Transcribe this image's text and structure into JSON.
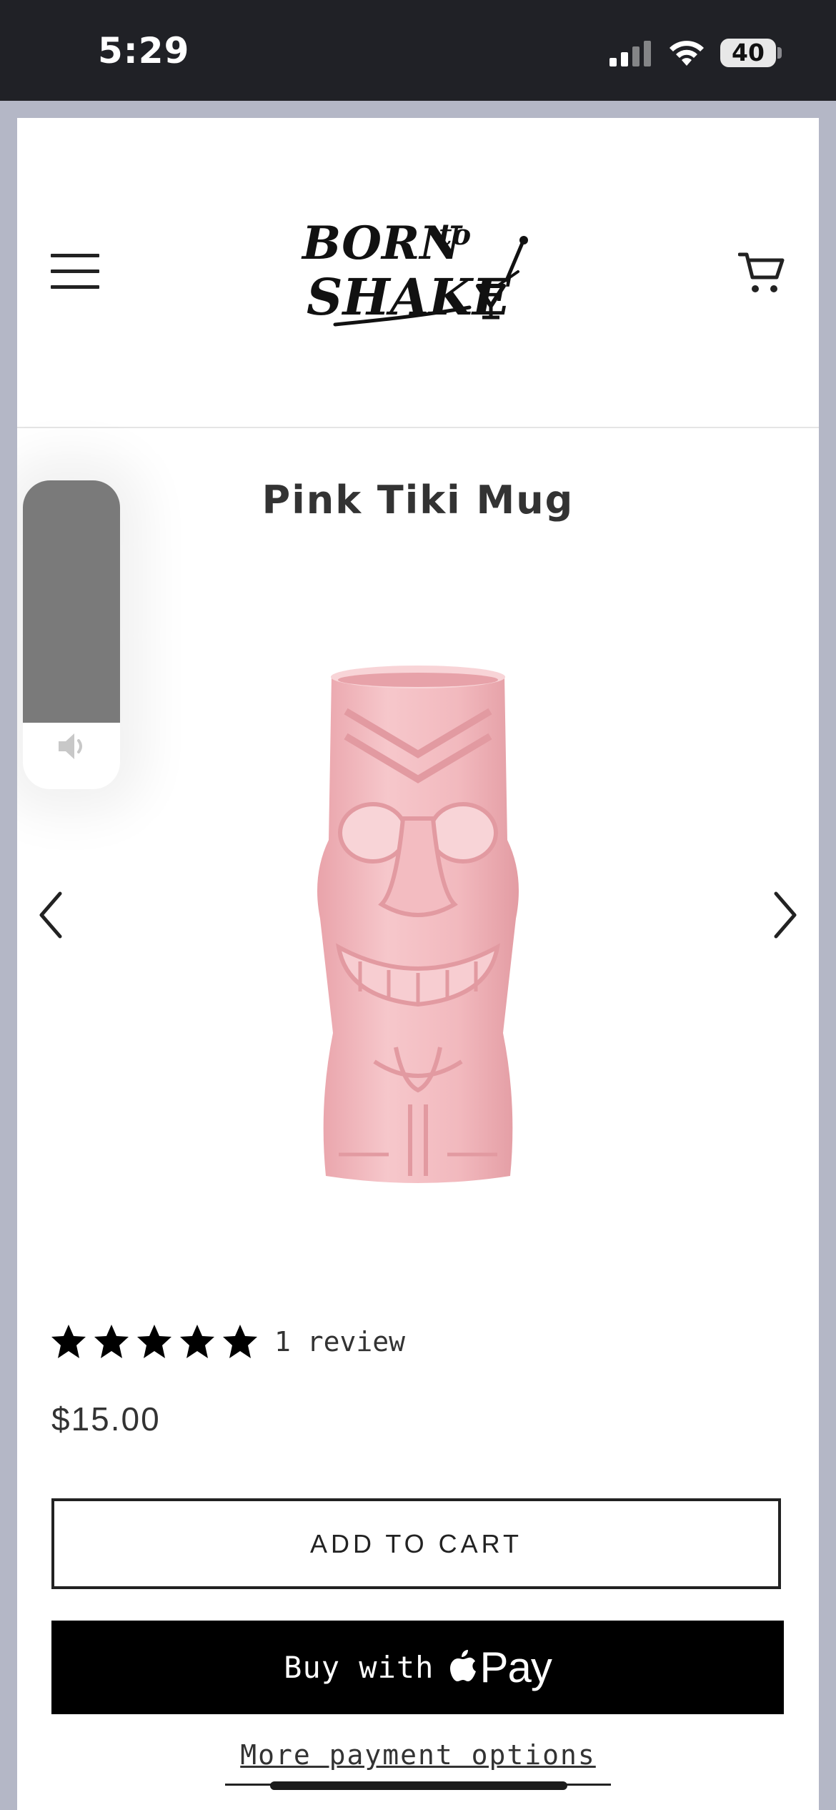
{
  "status_bar": {
    "time": "5:29",
    "battery": "40"
  },
  "header": {
    "logo_alt": "Born to Shake"
  },
  "product": {
    "title": "Pink Tiki Mug",
    "rating_stars": 5,
    "review_text": "1 review",
    "price": "$15.00"
  },
  "actions": {
    "add_to_cart": "ADD TO CART",
    "buy_with": "Buy with",
    "apple_pay": "Pay",
    "more_options": "More payment options"
  },
  "colors": {
    "accent": "#000000",
    "mug_pink": "#f2b9be",
    "status_bar_bg": "#202126",
    "page_bg": "#b4b7c6"
  },
  "icons": {
    "menu": "hamburger-icon",
    "cart": "cart-icon",
    "prev": "chevron-left-icon",
    "next": "chevron-right-icon",
    "volume": "speaker-icon",
    "apple": "apple-logo-icon"
  },
  "volume_level": 0.79
}
